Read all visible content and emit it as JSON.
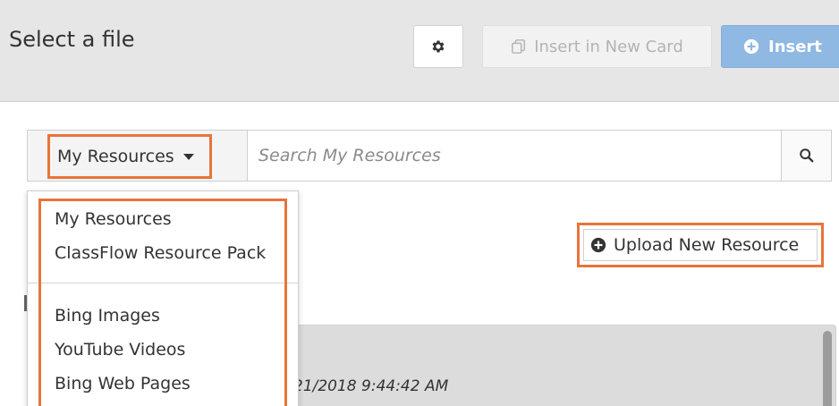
{
  "header": {
    "title": "Select a file",
    "settings_icon": "gear-icon",
    "insert_new_card_label": "Insert in New Card",
    "insert_label": "Insert"
  },
  "search": {
    "source_selected": "My Resources",
    "placeholder": "Search My Resources"
  },
  "source_menu": {
    "group1": [
      "My Resources",
      "ClassFlow Resource Pack"
    ],
    "group2": [
      "Bing Images",
      "YouTube Videos",
      "Bing Web Pages"
    ]
  },
  "upload": {
    "label": "Upload New Resource"
  },
  "resource_card": {
    "date": "21/2018 9:44:42 AM"
  },
  "colors": {
    "highlight": "#e8743b",
    "insert_button": "#8fb8e2",
    "header_bg": "#e6e6e6"
  }
}
